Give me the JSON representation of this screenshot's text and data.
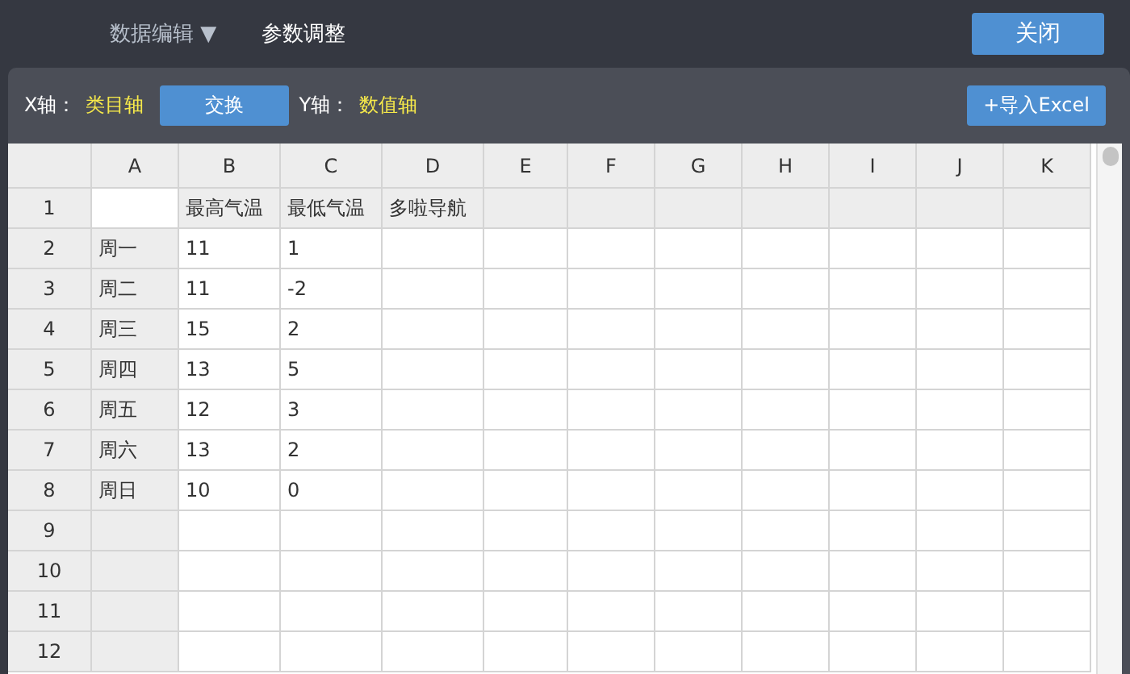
{
  "top_bar": {
    "menus": [
      {
        "label": "数据编辑",
        "caret": "▼",
        "selected": true
      },
      {
        "label": "参数调整",
        "selected": false
      }
    ],
    "close_button": "关闭"
  },
  "toolbar": {
    "x_axis_label": "X轴：",
    "x_axis_value": "类目轴",
    "swap_button": "交换",
    "y_axis_label": "Y轴：",
    "y_axis_value": "数值轴",
    "import_button": "+导入Excel"
  },
  "sheet": {
    "columns": [
      "A",
      "B",
      "C",
      "D",
      "E",
      "F",
      "G",
      "H",
      "I",
      "J",
      "K"
    ],
    "rows": [
      {
        "header": "1",
        "cells": [
          null,
          "最高气温",
          "最低气温",
          "多啦导航"
        ]
      },
      {
        "header": "2",
        "cells": [
          "周一",
          "11",
          "1"
        ]
      },
      {
        "header": "3",
        "cells": [
          "周二",
          "11",
          "-2"
        ]
      },
      {
        "header": "4",
        "cells": [
          "周三",
          "15",
          "2"
        ]
      },
      {
        "header": "5",
        "cells": [
          "周四",
          "13",
          "5"
        ]
      },
      {
        "header": "6",
        "cells": [
          "周五",
          "12",
          "3"
        ]
      },
      {
        "header": "7",
        "cells": [
          "周六",
          "13",
          "2"
        ]
      },
      {
        "header": "8",
        "cells": [
          "周日",
          "10",
          "0"
        ]
      },
      {
        "header": "9",
        "cells": []
      },
      {
        "header": "10",
        "cells": []
      },
      {
        "header": "11",
        "cells": []
      },
      {
        "header": "12",
        "cells": []
      }
    ]
  }
}
